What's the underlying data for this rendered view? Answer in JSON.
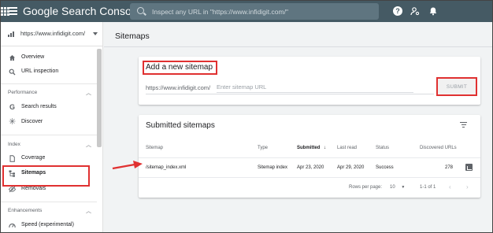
{
  "topbar": {
    "logo": "Google Search Console",
    "search_placeholder": "Inspect any URL in \"https://www.infidigit.com/\"",
    "help": "?"
  },
  "sidebar": {
    "property": "https://www.infidigit.com/",
    "items_top": [
      {
        "label": "Overview",
        "icon": "home-icon"
      },
      {
        "label": "URL inspection",
        "icon": "search-icon"
      }
    ],
    "performance_section": "Performance",
    "performance_items": [
      {
        "label": "Search results",
        "icon": "google-g-icon"
      },
      {
        "label": "Discover",
        "icon": "asterisk-icon"
      }
    ],
    "index_section": "Index",
    "index_items": [
      {
        "label": "Coverage",
        "icon": "document-icon"
      },
      {
        "label": "Sitemaps",
        "icon": "sitemap-icon",
        "active": true
      },
      {
        "label": "Removals",
        "icon": "eye-off-icon"
      }
    ],
    "enhancements_section": "Enhancements",
    "enhancements_items": [
      {
        "label": "Speed (experimental)",
        "icon": "speed-icon"
      }
    ]
  },
  "main": {
    "title": "Sitemaps",
    "add_card": {
      "title": "Add a new sitemap",
      "prefix": "https://www.infidigit.com/",
      "placeholder": "Enter sitemap URL",
      "submit_label": "SUBMIT"
    },
    "list_card": {
      "title": "Submitted sitemaps",
      "columns": [
        "Sitemap",
        "Type",
        "Submitted",
        "Last read",
        "Status",
        "Discovered URLs"
      ],
      "rows": [
        {
          "sitemap": "/sitemap_index.xml",
          "type": "Sitemap index",
          "submitted": "Apr 23, 2020",
          "last_read": "Apr 29, 2020",
          "status": "Success",
          "discovered": "278"
        }
      ],
      "rows_per_page_label": "Rows per page:",
      "rows_per_page_value": "10",
      "range": "1-1 of 1"
    }
  },
  "colors": {
    "topbar": "#455a64",
    "annotation": "#e03131"
  }
}
